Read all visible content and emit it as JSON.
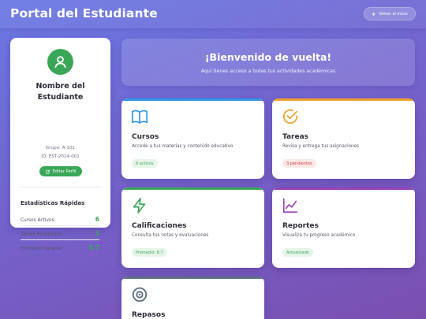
{
  "header": {
    "title": "Portal del Estudiante",
    "back_label": "Volver al Inicio"
  },
  "profile": {
    "name": "Nombre del Estudiante",
    "group": "Grupo: A-101",
    "id": "ID: EST-2024-001",
    "edit_label": "Editar Perfil"
  },
  "stats": {
    "title": "Estadísticas Rápidas",
    "items": [
      {
        "label": "Cursos Activos:",
        "value": "6"
      },
      {
        "label": "Tareas Pendientes:",
        "value": "3"
      },
      {
        "label": "Promedio General:",
        "value": "8.7"
      }
    ]
  },
  "welcome": {
    "title": "¡Bienvenido de vuelta!",
    "subtitle": "Aquí tienes acceso a todas tus actividades académicas"
  },
  "cards": [
    {
      "title": "Cursos",
      "description": "Accede a tus materias y contenido educativo",
      "badge": "6 activos",
      "icon": "book-icon",
      "accent": "#2f97e6"
    },
    {
      "title": "Tareas",
      "description": "Revisa y entrega tus asignaciones",
      "badge": "3 pendientes",
      "icon": "check-circle-icon",
      "accent": "#f0a030"
    },
    {
      "title": "Calificaciones",
      "description": "Consulta tus notas y evaluaciones",
      "badge": "Promedio: 8.7",
      "icon": "lightning-icon",
      "accent": "#3aa757"
    },
    {
      "title": "Reportes",
      "description": "Visualiza tu progreso académico",
      "badge": "Actualizado",
      "icon": "chart-line-icon",
      "accent": "#9b3fb5"
    },
    {
      "title": "Repasos",
      "description": "",
      "badge": "",
      "icon": "target-icon",
      "accent": "#5a6f80"
    }
  ],
  "colors": {
    "accent_green": "#3aa757",
    "badge_green_bg": "#e6f5ea",
    "badge_red_bg": "#fde8e8",
    "badge_red_text": "#d23c3c"
  }
}
